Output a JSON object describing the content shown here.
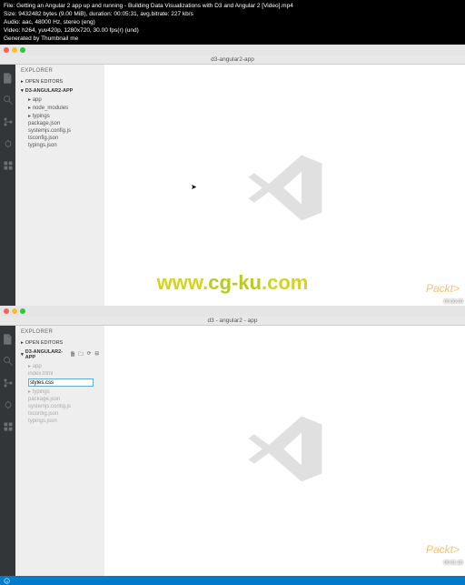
{
  "terminal": {
    "line1": "File: Getting an Angular 2 app up and running - Building Data Visualizations with D3 and Angular 2 [Video].mp4",
    "line2": "Size: 9432482 bytes (9.00 MiB), duration: 00:05:31, avg.bitrate: 227 kb/s",
    "line3": "Audio: aac, 48000 Hz, stereo (eng)",
    "line4": "Video: h264, yuv420p, 1280x720, 30.00 fps(r) (und)",
    "line5": "Generated by Thumbnail me"
  },
  "pane1": {
    "title": "d3-angular2-app",
    "explorer": "EXPLORER",
    "openEditors": "OPEN EDITORS",
    "project": "D3-ANGULAR2-APP",
    "files": [
      "app",
      "node_modules",
      "typings",
      "package.json",
      "systemjs.config.js",
      "tsconfig.json",
      "typings.json"
    ],
    "time": "00:00:09"
  },
  "pane2": {
    "title": "d3 - angular2 - app",
    "explorer": "EXPLORER",
    "openEditors": "OPEN EDITORS",
    "project": "D3-ANGULAR2-APP",
    "files": [
      "app",
      "index.html",
      "styles.css",
      "typings",
      "package.json",
      "systemjs.config.js",
      "tsconfig.json",
      "typings.json"
    ],
    "inputValue": "styles.css",
    "time": "00:01:26"
  },
  "watermark": {
    "text1": "www.cg-ku.com"
  },
  "packt": "Packt>"
}
